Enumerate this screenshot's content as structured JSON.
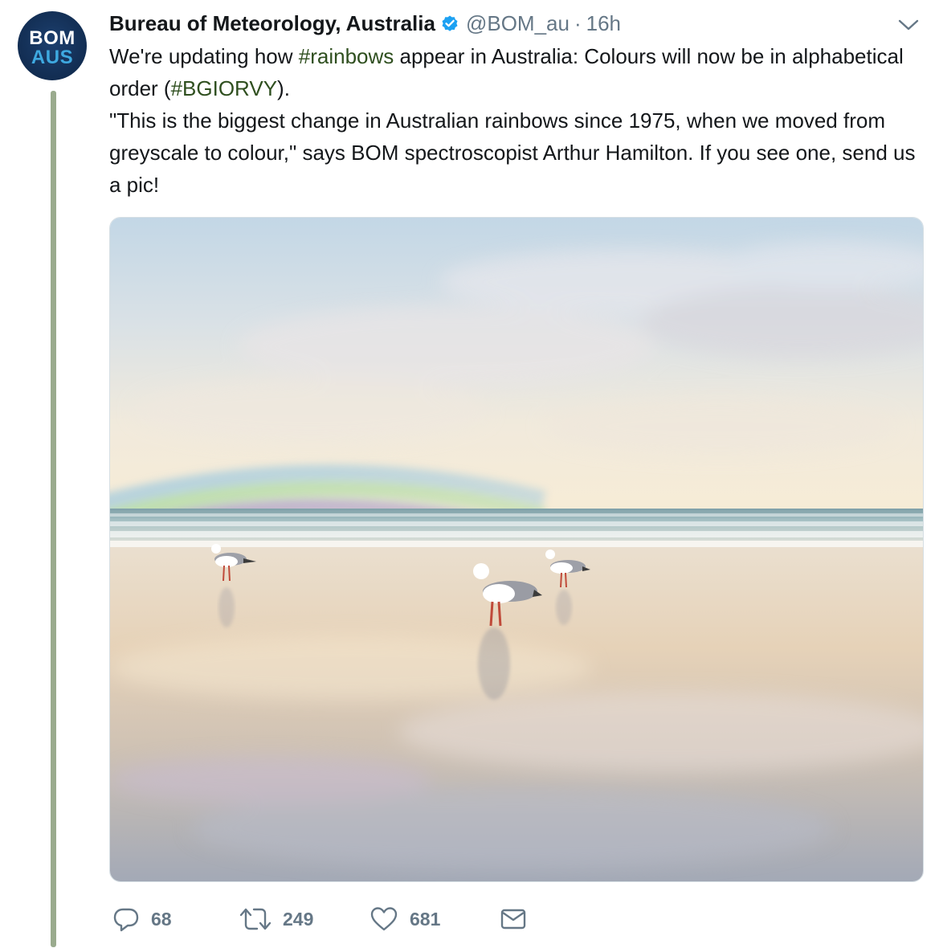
{
  "account": {
    "avatar_line1": "BOM",
    "avatar_line2": "AUS",
    "name": "Bureau of Meteorology, Australia",
    "handle": "@BOM_au",
    "separator": "·",
    "time": "16h"
  },
  "tweet": {
    "line1_pre": "We're updating how ",
    "hashtag1": "#rainbows",
    "line1_post": " appear in Australia: Colours will now be in alphabetical order (",
    "hashtag2": "#BGIORVY",
    "line1_end": ").",
    "line2": "\"This is the biggest change in Australian rainbows since 1975, when we moved from greyscale to colour,\" says BOM spectroscopist Arthur Hamilton. If you see one, send us a pic!"
  },
  "actions": {
    "replies": "68",
    "retweets": "249",
    "likes": "681"
  },
  "icons": {
    "verified": "verified-badge-icon",
    "caret": "chevron-down-icon",
    "reply": "reply-icon",
    "retweet": "retweet-icon",
    "like": "heart-icon",
    "dm": "envelope-icon"
  },
  "colors": {
    "text": "#14171a",
    "muted": "#657786",
    "hashtag": "#2f4f1f",
    "verified": "#1da1f2",
    "thread_line": "#9aab8e",
    "avatar_bg": "#122d52",
    "avatar_accent": "#3ea9e0"
  }
}
